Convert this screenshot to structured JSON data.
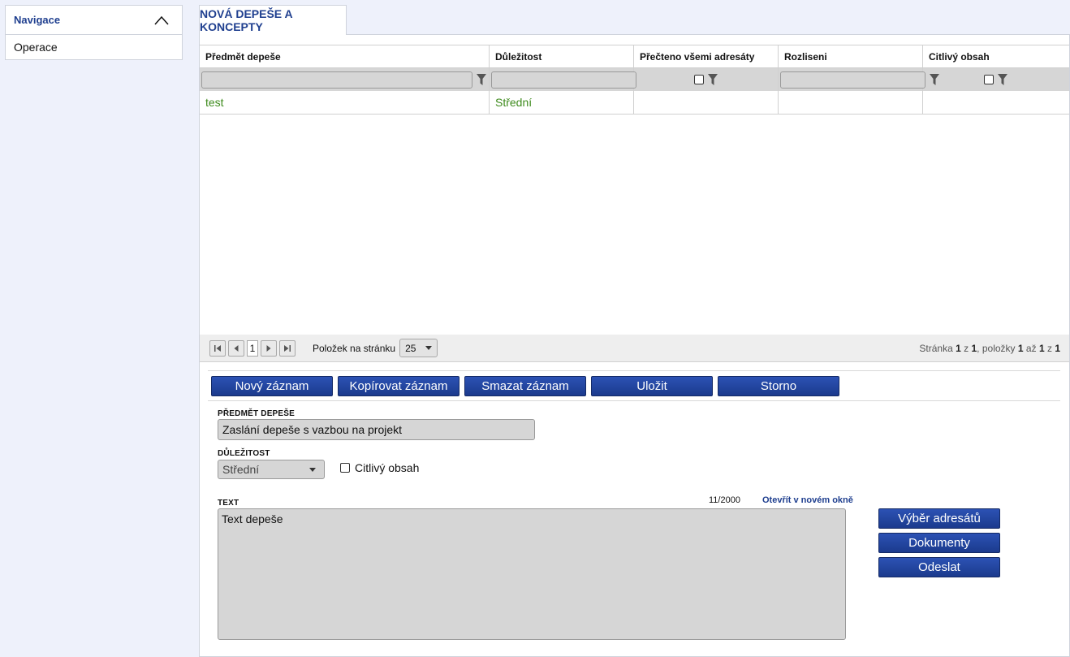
{
  "navigation": {
    "title": "Navigace",
    "items": [
      {
        "label": "Operace"
      }
    ]
  },
  "tab": {
    "label": "NOVÁ DEPEŠE A KONCEPTY"
  },
  "grid": {
    "columns": [
      "Předmět depeše",
      "Důležitost",
      "Přečteno všemi adresáty",
      "Rozliseni",
      "Citlivý obsah"
    ],
    "rows": [
      {
        "subject": "test",
        "importance": "Střední",
        "read_all": "",
        "resolution": "",
        "sensitive": ""
      }
    ]
  },
  "pager": {
    "current_page": "1",
    "per_page_label": "Položek na stránku",
    "per_page_value": "25",
    "info": {
      "prefix": "Stránka",
      "page": "1",
      "of": "z",
      "pages": "1",
      "items_label": ", položky",
      "from": "1",
      "to_word": "až",
      "to": "1",
      "of2": "z",
      "total": "1"
    }
  },
  "toolbar": {
    "new_label": "Nový záznam",
    "copy_label": "Kopírovat záznam",
    "delete_label": "Smazat záznam",
    "save_label": "Uložit",
    "cancel_label": "Storno"
  },
  "form": {
    "subject_label": "PŘEDMĚT DEPEŠE",
    "subject_value": "Zaslání depeše s vazbou na projekt",
    "importance_label": "DŮLEŽITOST",
    "importance_value": "Střední",
    "sensitive_label": "Citlivý obsah",
    "text_label": "TEXT",
    "text_counter": "11/2000",
    "open_new_window": "Otevřít v novém okně",
    "text_value": "Text depeše"
  },
  "actions": {
    "recipients_label": "Výběr adresátů",
    "documents_label": "Dokumenty",
    "send_label": "Odeslat"
  },
  "colors": {
    "accent": "#1f3f8f",
    "button": "#2c52b4",
    "data_text": "#3e8b1d",
    "background": "#eef1fb"
  }
}
